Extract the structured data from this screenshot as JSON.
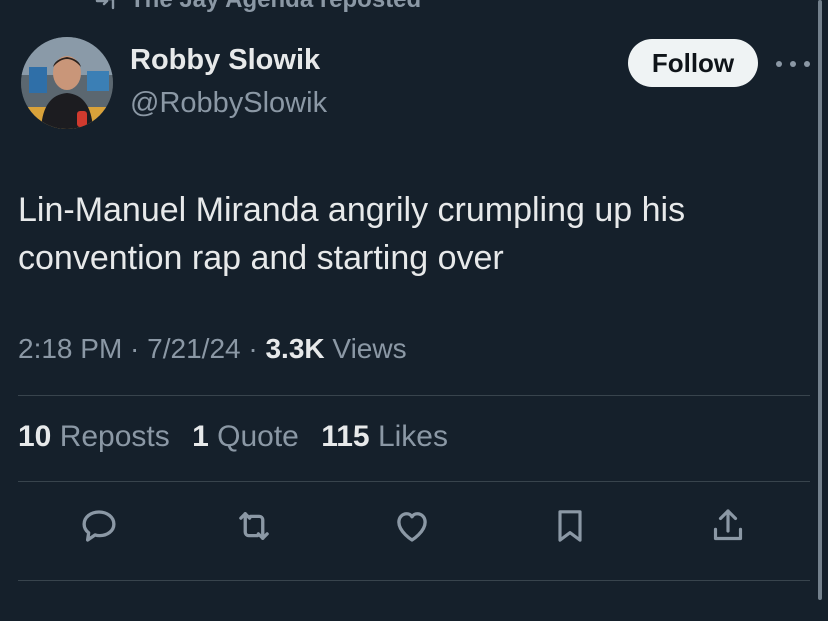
{
  "header": {
    "repost_text": "The Jay Agenda reposted"
  },
  "author": {
    "name": "Robby Slowik",
    "handle": "@RobbySlowik"
  },
  "follow_label": "Follow",
  "tweet": {
    "line1": "Lin-Manuel Miranda angrily crumpling up his",
    "line2": "convention rap and starting over"
  },
  "meta": {
    "time": "2:18 PM",
    "sep1": " · ",
    "date": "7/21/24",
    "sep2": " · ",
    "views_count": "3.3K",
    "views_label": " Views"
  },
  "stats": {
    "reposts_count": "10",
    "reposts_label": " Reposts",
    "quotes_count": "1",
    "quotes_label": " Quote",
    "likes_count": "115",
    "likes_label": " Likes"
  },
  "icons": {
    "reply": "reply-icon",
    "repost": "repost-icon",
    "like": "like-icon",
    "bookmark": "bookmark-icon",
    "share": "share-icon"
  },
  "colors": {
    "background": "#15202b",
    "text_primary": "#e7e9ea",
    "text_secondary": "#8b98a5",
    "follow_button_bg": "#eff3f4"
  }
}
